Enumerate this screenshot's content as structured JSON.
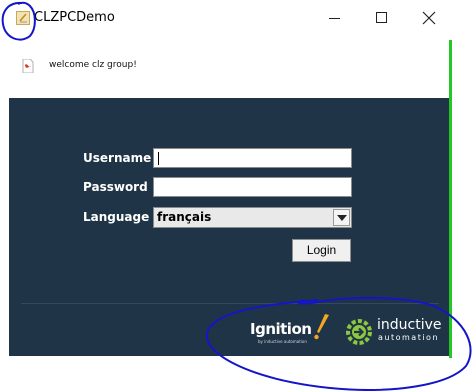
{
  "window": {
    "title": "CLZPCDemo",
    "controls": [
      "minimize",
      "maximize",
      "close"
    ]
  },
  "welcome": {
    "text": "welcome clz group!",
    "icon": "pdf-icon"
  },
  "login_form": {
    "username_label": "Username",
    "username_value": "",
    "password_label": "Password",
    "password_value": "",
    "language_label": "Language",
    "language_selected": "français",
    "login_label": "Login"
  },
  "branding": {
    "ignition_text": "Ignition",
    "ignition_sub": "by inductive automation",
    "inductive_line1": "inductive",
    "inductive_line2": "automation"
  },
  "colors": {
    "panel_bg": "#1f3447",
    "accent_orange": "#f5a623",
    "accent_green": "#27c627",
    "annotation_blue": "#1515c8"
  }
}
